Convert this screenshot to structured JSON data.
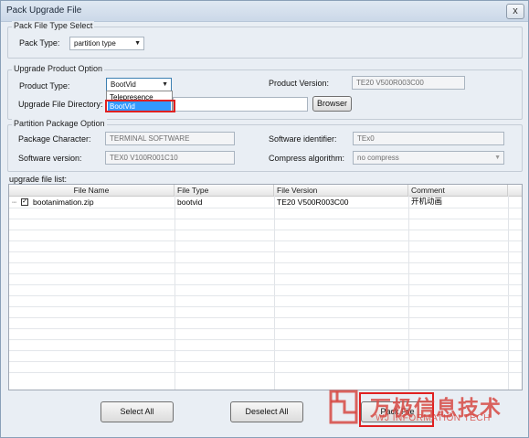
{
  "window": {
    "title": "Pack Upgrade File",
    "close_label": "x"
  },
  "pack_type_group": {
    "legend": "Pack File Type Select",
    "label": "Pack Type:",
    "value": "partition type"
  },
  "upgrade_group": {
    "legend": "Upgrade Product Option",
    "product_type_label": "Product Type:",
    "product_type_value": "BootVid",
    "product_type_options": [
      "Telepresence",
      "BootVid"
    ],
    "product_version_label": "Product Version:",
    "product_version_value": "TE20 V500R003C00",
    "directory_label": "Upgrade File Directory:",
    "directory_value": "",
    "browser_label": "Browser"
  },
  "partition_group": {
    "legend": "Partition Package Option",
    "package_character_label": "Package Character:",
    "package_character_value": "TERMINAL SOFTWARE",
    "software_identifier_label": "Software identifier:",
    "software_identifier_value": "TEx0",
    "software_version_label": "Software version:",
    "software_version_value": "TEX0 V100R001C10",
    "compress_label": "Compress algorithm:",
    "compress_value": "no compress"
  },
  "file_list": {
    "label": "upgrade file list:",
    "columns": [
      "File Name",
      "File Type",
      "File Version",
      "Comment"
    ],
    "rows": [
      {
        "checked": true,
        "name": "bootanimation.zip",
        "type": "bootvid",
        "version": "TE20 V500R003C00",
        "comment": "开机动画"
      }
    ]
  },
  "buttons": {
    "select_all": "Select All",
    "deselect_all": "Deselect All",
    "pack_file": "Pack File"
  },
  "watermark": {
    "cn": "万极信息技术",
    "en": "WJ INFORMATION TECH"
  },
  "colors": {
    "highlight": "#e02020",
    "selection": "#3399ff",
    "watermark": "#d64842"
  }
}
